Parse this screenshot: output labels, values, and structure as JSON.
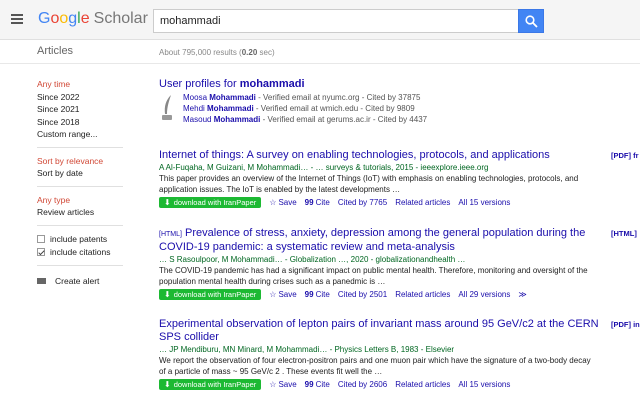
{
  "header": {
    "logo_google": "Google",
    "logo_scholar": "Scholar",
    "search_value": "mohammadi"
  },
  "subheader": {
    "section": "Articles",
    "results_prefix": "About 795,000 results (",
    "results_time": "0.20",
    "results_suffix": " sec)"
  },
  "sidebar": {
    "time_filters": [
      "Any time",
      "Since 2022",
      "Since 2021",
      "Since 2018",
      "Custom range..."
    ],
    "sort_options": [
      "Sort by relevance",
      "Sort by date"
    ],
    "type_options": [
      "Any type",
      "Review articles"
    ],
    "include_patents": "include patents",
    "include_citations": "include citations",
    "create_alert": "Create alert"
  },
  "profiles": {
    "title_prefix": "User profiles for ",
    "title_query": "mohammadi",
    "items": [
      {
        "first": "Moosa ",
        "last": "Mohammadi",
        "info": " - Verified email at nyumc.org - Cited by 37875"
      },
      {
        "first": "Mehdi ",
        "last": "Mohammadi",
        "info": " - Verified email at wmich.edu - Cited by 9809"
      },
      {
        "first": "Masoud ",
        "last": "Mohammadi",
        "info": " - Verified email at gerums.ac.ir - Cited by 4437"
      }
    ]
  },
  "results": [
    {
      "tag": "",
      "title": "Internet of things: A survey on enabling technologies, protocols, and applications",
      "authors": "A Al-Fuqaha, M Guizani, M Mohammadi… - … surveys & tutorials, 2015 - ieeexplore.ieee.org",
      "snippet": "This paper provides an overview of the Internet of Things (IoT) with emphasis on enabling technologies, protocols, and application issues. The IoT is enabled by the latest developments …",
      "download": "download with IranPaper",
      "save": "Save",
      "cite": "Cite",
      "cited_by": "Cited by 7765",
      "related": "Related articles",
      "versions": "All 15 versions",
      "pdf": "[PDF] fr"
    },
    {
      "tag": "[HTML]",
      "title": "Prevalence of stress, anxiety, depression among the general population during the COVID-19 pandemic: a systematic review and meta-analysis",
      "authors": "… S Rasoulpoor, M Mohammadi… - Globalization …, 2020 - globalizationandhealth …",
      "snippet": "The COVID-19 pandemic has had a significant impact on public mental health. Therefore, monitoring and oversight of the population mental health during crises such as a panedmic is …",
      "download": "download with IranPaper",
      "save": "Save",
      "cite": "Cite",
      "cited_by": "Cited by 2501",
      "related": "Related articles",
      "versions": "All 29 versions",
      "pdf": "[HTML]"
    },
    {
      "tag": "",
      "title": "Experimental observation of lepton pairs of invariant mass around 95 GeV/c2 at the CERN SPS collider",
      "authors": "… JP Mendiburu, MN Minard, M Mohammadi… - Physics Letters B, 1983 - Elsevier",
      "snippet": "We report the observation of four electron-positron pairs and one muon pair which have the signature of a two-body decay of a particle of mass ~ 95 GeV/c 2 . These events fit well the …",
      "download": "download with IranPaper",
      "save": "Save",
      "cite": "Cite",
      "cited_by": "Cited by 2606",
      "related": "Related articles",
      "versions": "All 15 versions",
      "pdf": "[PDF] in"
    }
  ]
}
